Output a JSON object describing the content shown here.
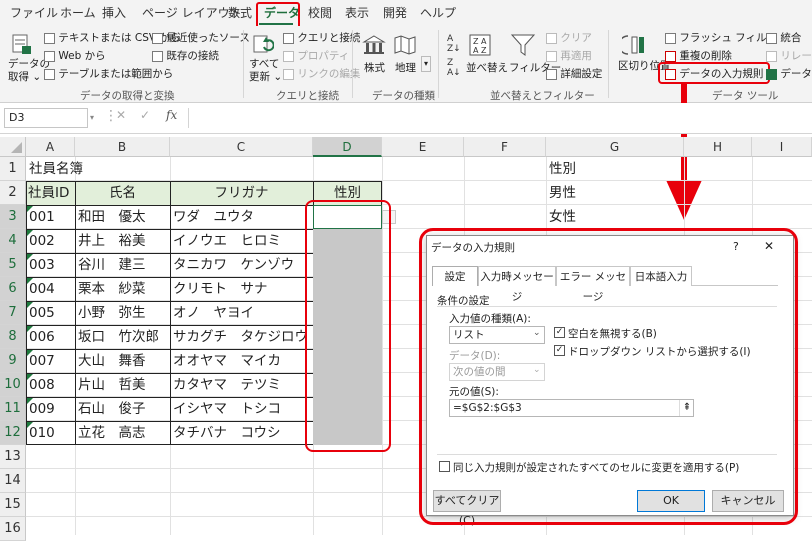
{
  "menu": {
    "tabs": [
      "ファイル",
      "ホーム",
      "挿入",
      "ページ レイアウト",
      "数式",
      "データ",
      "校閲",
      "表示",
      "開発",
      "ヘルプ"
    ],
    "active": "データ"
  },
  "ribbon": {
    "get_data": {
      "line1": "データの",
      "line2": "取得 ⌄"
    },
    "text_csv": "テキストまたは CSV から",
    "web": "Web から",
    "table_range": "テーブルまたは範囲から",
    "recent_sources": "最近使ったソース",
    "existing_conn": "既存の接続",
    "group_get": "データの取得と変換",
    "refresh_all": {
      "line1": "すべて",
      "line2": "更新 ⌄"
    },
    "queries_conn": "クエリと接続",
    "properties": "プロパティ",
    "edit_links": "リンクの編集",
    "group_queries": "クエリと接続",
    "stocks": "株式",
    "geography": "地理",
    "group_types": "データの種類",
    "sort": "並べ替え",
    "filter": "フィルター",
    "clear": "クリア",
    "reapply": "再適用",
    "advanced": "詳細設定",
    "group_sort": "並べ替えとフィルター",
    "text_to_cols": "区切り位置",
    "flash_fill": "フラッシュ フィル",
    "remove_dup": "重複の削除",
    "data_validation": "データの入力規則",
    "group_tools": "データ ツール",
    "consolidate": "統合",
    "relationships": "リレーション",
    "data_model": "データ モ"
  },
  "formula_bar": {
    "name_box": "D3",
    "fx": "fx",
    "cancel": "✕",
    "enter": "✓",
    "value": ""
  },
  "columns": [
    "A",
    "B",
    "C",
    "D",
    "E",
    "F",
    "G",
    "H",
    "I"
  ],
  "rows": [
    "1",
    "2",
    "3",
    "4",
    "5",
    "6",
    "7",
    "8",
    "9",
    "10",
    "11",
    "12",
    "13",
    "14",
    "15",
    "16"
  ],
  "sheet": {
    "title": "社員名簿",
    "headers": {
      "id": "社員ID",
      "name": "氏名",
      "kana": "フリガナ",
      "gender": "性別"
    },
    "employees": [
      {
        "id": "001",
        "name": "和田　優太",
        "kana": "ワダ　ユウタ"
      },
      {
        "id": "002",
        "name": "井上　裕美",
        "kana": "イノウエ　ヒロミ"
      },
      {
        "id": "003",
        "name": "谷川　建三",
        "kana": "タニカワ　ケンゾウ"
      },
      {
        "id": "004",
        "name": "栗本　紗菜",
        "kana": "クリモト　サナ"
      },
      {
        "id": "005",
        "name": "小野　弥生",
        "kana": "オノ　ヤヨイ"
      },
      {
        "id": "006",
        "name": "坂口　竹次郎",
        "kana": "サカグチ　タケジロウ"
      },
      {
        "id": "007",
        "name": "大山　舞香",
        "kana": "オオヤマ　マイカ"
      },
      {
        "id": "008",
        "name": "片山　哲美",
        "kana": "カタヤマ　テツミ"
      },
      {
        "id": "009",
        "name": "石山　俊子",
        "kana": "イシヤマ　トシコ"
      },
      {
        "id": "010",
        "name": "立花　高志",
        "kana": "タチバナ　コウシ"
      }
    ],
    "g_list": [
      "性別",
      "男性",
      "女性"
    ]
  },
  "dialog": {
    "title": "データの入力規則",
    "help": "?",
    "close": "✕",
    "tabs": [
      "設定",
      "入力時メッセージ",
      "エラー メッセージ",
      "日本語入力"
    ],
    "section": "条件の設定",
    "allow_label": "入力値の種類(A):",
    "allow_value": "リスト",
    "ignore_blank": "空白を無視する(B)",
    "dropdown": "ドロップダウン リストから選択する(I)",
    "data_label": "データ(D):",
    "data_value": "次の値の間",
    "source_label": "元の値(S):",
    "source_value": "=$G$2:$G$3",
    "apply_all": "同じ入力規則が設定されたすべてのセルに変更を適用する(P)",
    "clear_all": "すべてクリア(C)",
    "ok": "OK",
    "cancel": "キャンセル"
  },
  "colors": {
    "accent": "#217346",
    "highlight": "#e8000b",
    "header_fill": "#e2efda",
    "selection_fill": "#c8c8c8"
  }
}
